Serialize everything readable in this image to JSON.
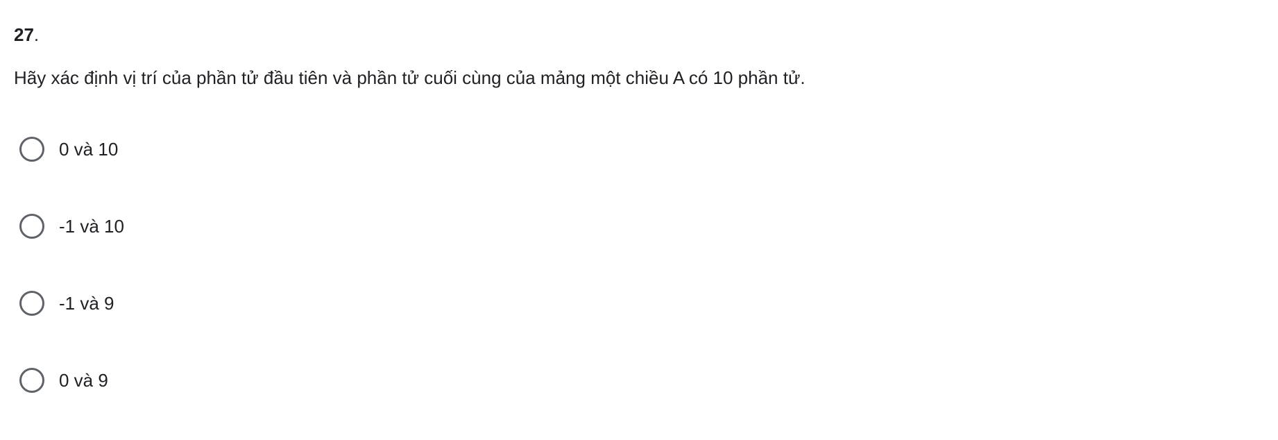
{
  "question": {
    "number": "27",
    "number_suffix": ".",
    "text": "Hãy xác định vị trí của phần tử đầu tiên và phần tử cuối cùng của mảng một chiều A có 10 phần tử."
  },
  "options": [
    {
      "label": "0 và 10"
    },
    {
      "label": "-1 và 10"
    },
    {
      "label": "-1 và 9"
    },
    {
      "label": "0 và 9"
    }
  ]
}
